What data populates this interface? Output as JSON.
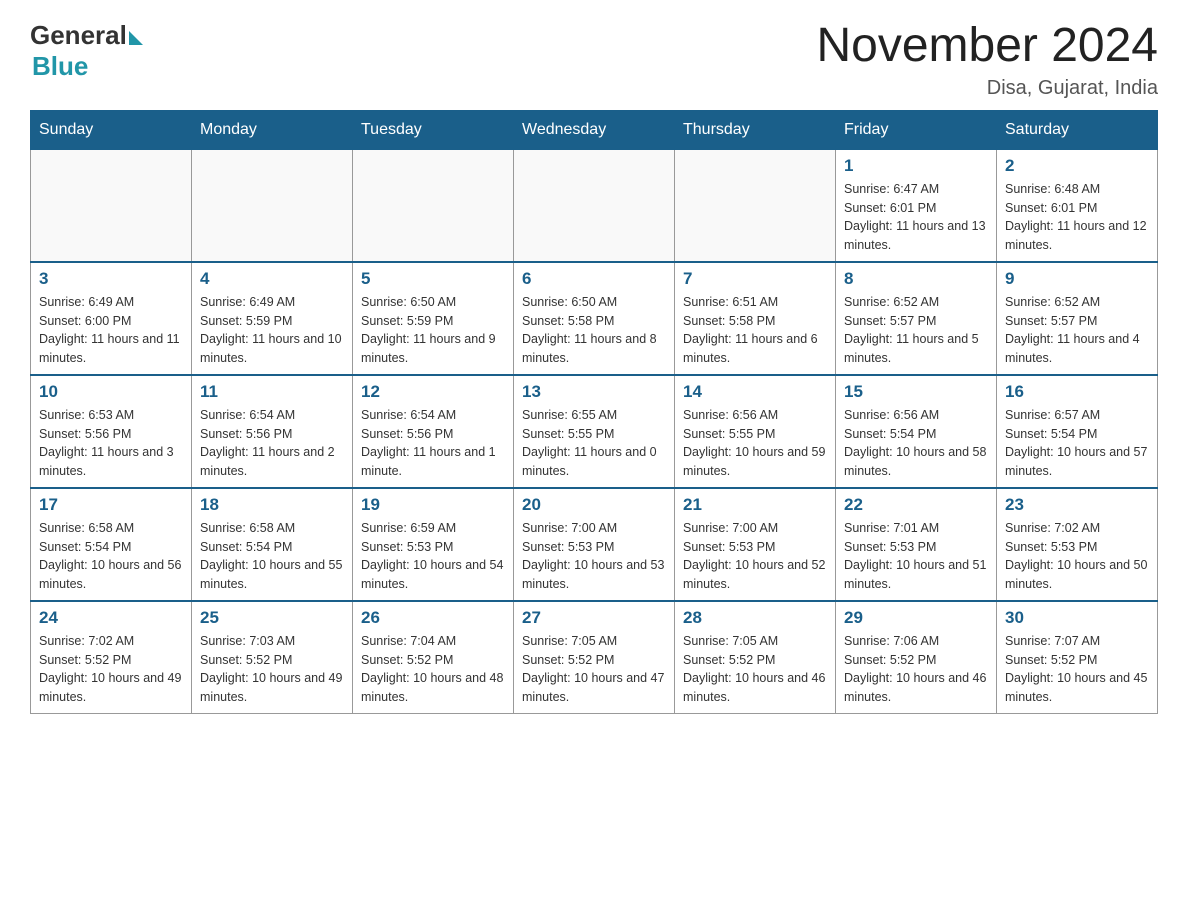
{
  "logo": {
    "general": "General",
    "blue": "Blue"
  },
  "header": {
    "month_title": "November 2024",
    "location": "Disa, Gujarat, India"
  },
  "weekdays": [
    "Sunday",
    "Monday",
    "Tuesday",
    "Wednesday",
    "Thursday",
    "Friday",
    "Saturday"
  ],
  "weeks": [
    [
      {
        "day": "",
        "info": ""
      },
      {
        "day": "",
        "info": ""
      },
      {
        "day": "",
        "info": ""
      },
      {
        "day": "",
        "info": ""
      },
      {
        "day": "",
        "info": ""
      },
      {
        "day": "1",
        "info": "Sunrise: 6:47 AM\nSunset: 6:01 PM\nDaylight: 11 hours and 13 minutes."
      },
      {
        "day": "2",
        "info": "Sunrise: 6:48 AM\nSunset: 6:01 PM\nDaylight: 11 hours and 12 minutes."
      }
    ],
    [
      {
        "day": "3",
        "info": "Sunrise: 6:49 AM\nSunset: 6:00 PM\nDaylight: 11 hours and 11 minutes."
      },
      {
        "day": "4",
        "info": "Sunrise: 6:49 AM\nSunset: 5:59 PM\nDaylight: 11 hours and 10 minutes."
      },
      {
        "day": "5",
        "info": "Sunrise: 6:50 AM\nSunset: 5:59 PM\nDaylight: 11 hours and 9 minutes."
      },
      {
        "day": "6",
        "info": "Sunrise: 6:50 AM\nSunset: 5:58 PM\nDaylight: 11 hours and 8 minutes."
      },
      {
        "day": "7",
        "info": "Sunrise: 6:51 AM\nSunset: 5:58 PM\nDaylight: 11 hours and 6 minutes."
      },
      {
        "day": "8",
        "info": "Sunrise: 6:52 AM\nSunset: 5:57 PM\nDaylight: 11 hours and 5 minutes."
      },
      {
        "day": "9",
        "info": "Sunrise: 6:52 AM\nSunset: 5:57 PM\nDaylight: 11 hours and 4 minutes."
      }
    ],
    [
      {
        "day": "10",
        "info": "Sunrise: 6:53 AM\nSunset: 5:56 PM\nDaylight: 11 hours and 3 minutes."
      },
      {
        "day": "11",
        "info": "Sunrise: 6:54 AM\nSunset: 5:56 PM\nDaylight: 11 hours and 2 minutes."
      },
      {
        "day": "12",
        "info": "Sunrise: 6:54 AM\nSunset: 5:56 PM\nDaylight: 11 hours and 1 minute."
      },
      {
        "day": "13",
        "info": "Sunrise: 6:55 AM\nSunset: 5:55 PM\nDaylight: 11 hours and 0 minutes."
      },
      {
        "day": "14",
        "info": "Sunrise: 6:56 AM\nSunset: 5:55 PM\nDaylight: 10 hours and 59 minutes."
      },
      {
        "day": "15",
        "info": "Sunrise: 6:56 AM\nSunset: 5:54 PM\nDaylight: 10 hours and 58 minutes."
      },
      {
        "day": "16",
        "info": "Sunrise: 6:57 AM\nSunset: 5:54 PM\nDaylight: 10 hours and 57 minutes."
      }
    ],
    [
      {
        "day": "17",
        "info": "Sunrise: 6:58 AM\nSunset: 5:54 PM\nDaylight: 10 hours and 56 minutes."
      },
      {
        "day": "18",
        "info": "Sunrise: 6:58 AM\nSunset: 5:54 PM\nDaylight: 10 hours and 55 minutes."
      },
      {
        "day": "19",
        "info": "Sunrise: 6:59 AM\nSunset: 5:53 PM\nDaylight: 10 hours and 54 minutes."
      },
      {
        "day": "20",
        "info": "Sunrise: 7:00 AM\nSunset: 5:53 PM\nDaylight: 10 hours and 53 minutes."
      },
      {
        "day": "21",
        "info": "Sunrise: 7:00 AM\nSunset: 5:53 PM\nDaylight: 10 hours and 52 minutes."
      },
      {
        "day": "22",
        "info": "Sunrise: 7:01 AM\nSunset: 5:53 PM\nDaylight: 10 hours and 51 minutes."
      },
      {
        "day": "23",
        "info": "Sunrise: 7:02 AM\nSunset: 5:53 PM\nDaylight: 10 hours and 50 minutes."
      }
    ],
    [
      {
        "day": "24",
        "info": "Sunrise: 7:02 AM\nSunset: 5:52 PM\nDaylight: 10 hours and 49 minutes."
      },
      {
        "day": "25",
        "info": "Sunrise: 7:03 AM\nSunset: 5:52 PM\nDaylight: 10 hours and 49 minutes."
      },
      {
        "day": "26",
        "info": "Sunrise: 7:04 AM\nSunset: 5:52 PM\nDaylight: 10 hours and 48 minutes."
      },
      {
        "day": "27",
        "info": "Sunrise: 7:05 AM\nSunset: 5:52 PM\nDaylight: 10 hours and 47 minutes."
      },
      {
        "day": "28",
        "info": "Sunrise: 7:05 AM\nSunset: 5:52 PM\nDaylight: 10 hours and 46 minutes."
      },
      {
        "day": "29",
        "info": "Sunrise: 7:06 AM\nSunset: 5:52 PM\nDaylight: 10 hours and 46 minutes."
      },
      {
        "day": "30",
        "info": "Sunrise: 7:07 AM\nSunset: 5:52 PM\nDaylight: 10 hours and 45 minutes."
      }
    ]
  ]
}
